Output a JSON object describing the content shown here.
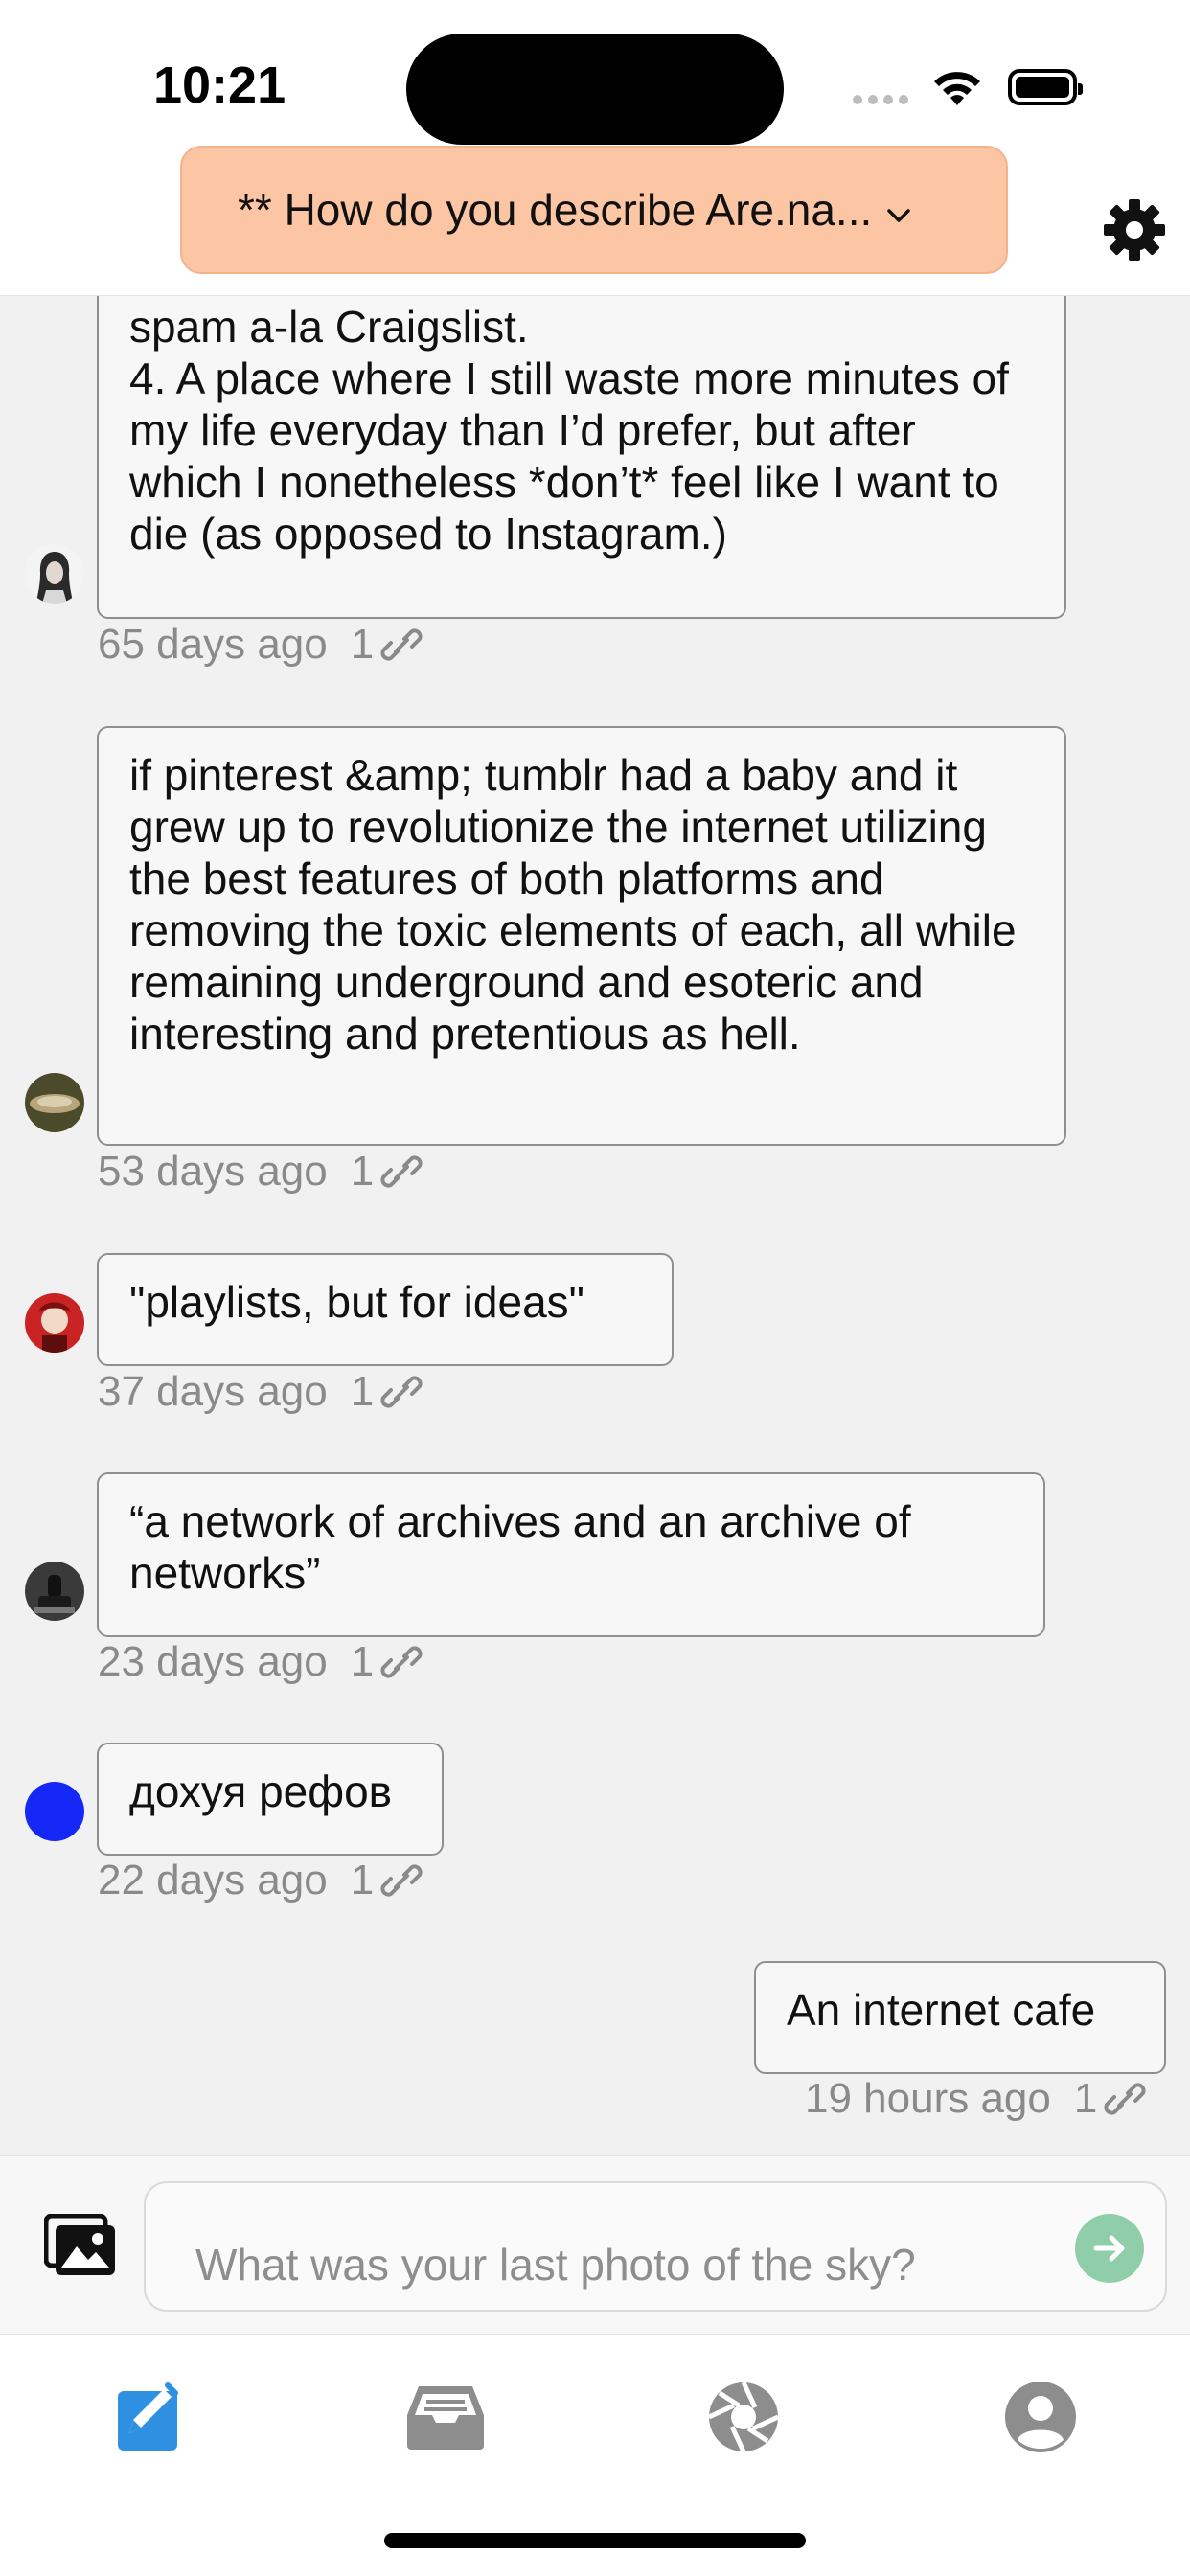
{
  "status_bar": {
    "time": "10:21"
  },
  "header": {
    "prompt_title": "** How do you describe Are.na...",
    "chevron_icon": "chevron-down-icon",
    "settings_icon": "gear-icon"
  },
  "messages": [
    {
      "text": "spam a-la Craigslist.\n4. A place where I still waste more minutes of my life everyday than I’d prefer, but after which I nonetheless *don’t* feel like I want to die (as opposed to Instagram.)",
      "time_ago": "65 days ago",
      "connections": "1"
    },
    {
      "text": "if pinterest &amp; tumblr had a baby and it grew up to revolutionize the internet utilizing the best features of both platforms and removing the toxic elements of each, all while remaining underground and esoteric and interesting and pretentious as hell.",
      "time_ago": "53 days ago",
      "connections": "1"
    },
    {
      "text": "\"playlists, but for ideas\"",
      "time_ago": "37 days ago",
      "connections": "1"
    },
    {
      "text": "“a network of archives and an archive of networks”",
      "time_ago": "23 days ago",
      "connections": "1"
    },
    {
      "text": "дохуя рефов",
      "time_ago": "22 days ago",
      "connections": "1"
    },
    {
      "text": "An internet cafe",
      "time_ago": "19 hours ago",
      "connections": "1"
    }
  ],
  "composer": {
    "placeholder": "What was your last photo of the sky?",
    "photo_icon": "photo-library-icon",
    "send_icon": "arrow-right-icon",
    "send_color": "#8fcea8"
  },
  "tabbar": {
    "tabs": [
      {
        "icon": "compose-icon",
        "active": true
      },
      {
        "icon": "inbox-icon",
        "active": false
      },
      {
        "icon": "aperture-icon",
        "active": false
      },
      {
        "icon": "profile-icon",
        "active": false
      }
    ],
    "active_color": "#2f8fe0",
    "inactive_color": "#8d8d8d"
  },
  "colors": {
    "prompt_pill": "#fcc6a4",
    "background": "#f1f1f1"
  }
}
